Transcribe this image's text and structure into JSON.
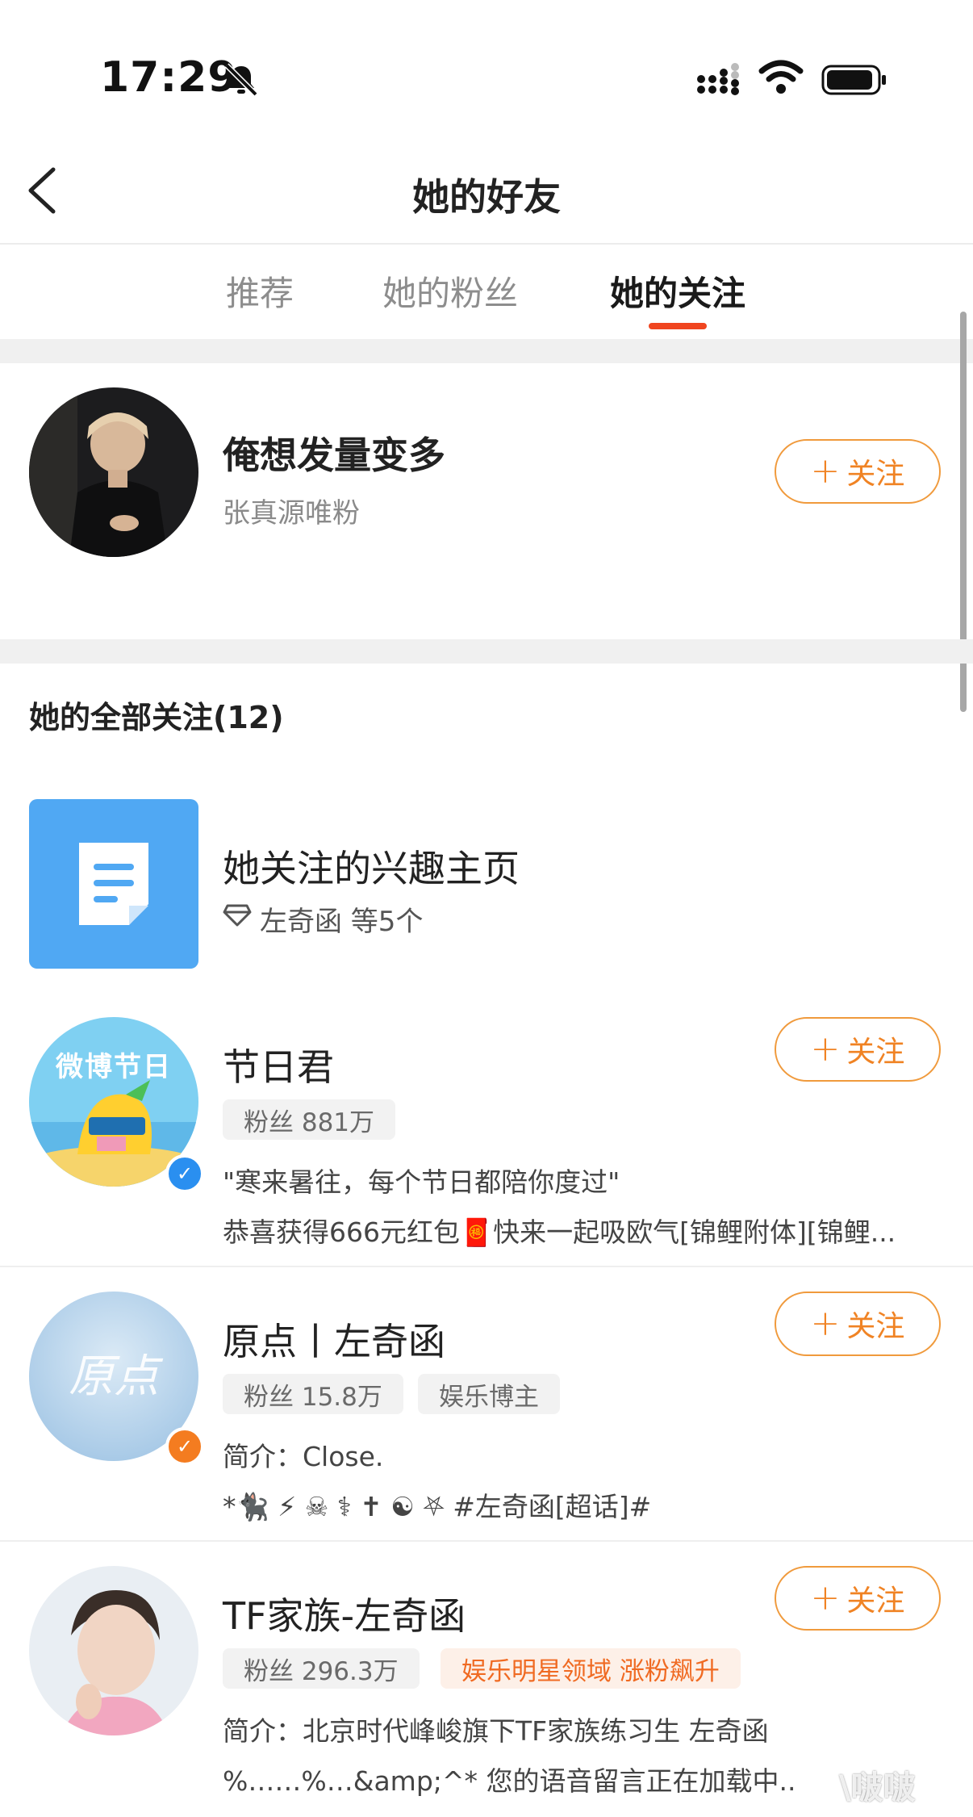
{
  "status": {
    "time": "17:29"
  },
  "header": {
    "title": "她的好友"
  },
  "tabs": [
    {
      "label": "推荐"
    },
    {
      "label": "她的粉丝"
    },
    {
      "label": "她的关注"
    }
  ],
  "featured": {
    "name": "俺想发量变多",
    "subtitle": "张真源唯粉",
    "follow_label": "关注"
  },
  "section": {
    "title": "她的全部关注(12)"
  },
  "interest": {
    "title": "她关注的兴趣主页",
    "subtitle": "左奇函 等5个"
  },
  "accounts": [
    {
      "name": "节日君",
      "fans": "粉丝 881万",
      "line1": "\"寒来暑往，每个节日都陪你度过\"",
      "line2": "恭喜获得666元红包🧧快来一起吸欧气[锦鲤附体][锦鲤...",
      "follow_label": "关注",
      "avatar_text": "微博节日",
      "badge_color": "#2a8ff0"
    },
    {
      "name": "原点丨左奇函",
      "fans": "粉丝 15.8万",
      "tag": "娱乐博主",
      "line1": "简介：Close.",
      "line2": "*🐈‍⬛ ⚡ ☠ ⚕ ✝ ☯ ⛧ #左奇函[超话]#",
      "follow_label": "关注",
      "avatar_text": "原点",
      "badge_color": "#f47c20"
    },
    {
      "name": "TF家族-左奇函",
      "fans": "粉丝 296.3万",
      "tag": "娱乐明星领域 涨粉飙升",
      "line1": "简介：北京时代峰峻旗下TF家族练习生 左奇函",
      "line2": "%……%…&amp;^* 您的语音留言正在加载中..",
      "follow_label": "关注"
    }
  ],
  "watermark": "\\啵啵"
}
